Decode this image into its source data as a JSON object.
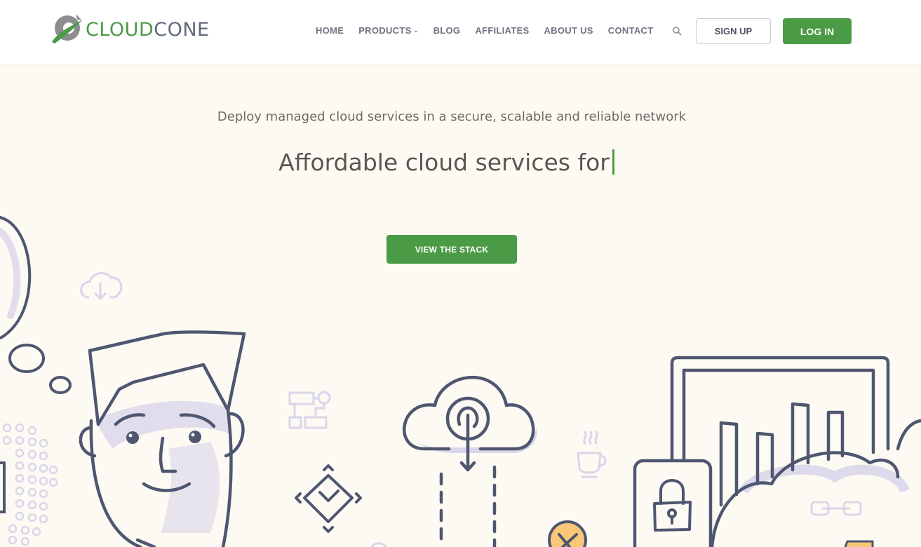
{
  "brand": {
    "logo_part1": "CLOUD",
    "logo_part2": "CONE"
  },
  "nav": {
    "items": [
      "HOME",
      "PRODUCTS",
      "BLOG",
      "AFFILIATES",
      "ABOUT US",
      "CONTACT"
    ]
  },
  "header": {
    "signup_label": "SIGN UP",
    "login_label": "LOG IN"
  },
  "hero": {
    "subtitle": "Deploy managed cloud services in a secure, scalable and reliable network",
    "headline": "Affordable cloud services for",
    "cta_label": "VIEW THE STACK"
  },
  "colors": {
    "accent": "#4b9a45",
    "background": "#fdfaf3",
    "ink": "#4e5670",
    "soft": "#d9d6ea"
  },
  "icons": [
    "logo-icon",
    "search-icon",
    "chevron-down-icon",
    "cloud-download-icon",
    "flowchart-icon",
    "coffee-cup-icon",
    "link-icon",
    "lock-icon"
  ]
}
